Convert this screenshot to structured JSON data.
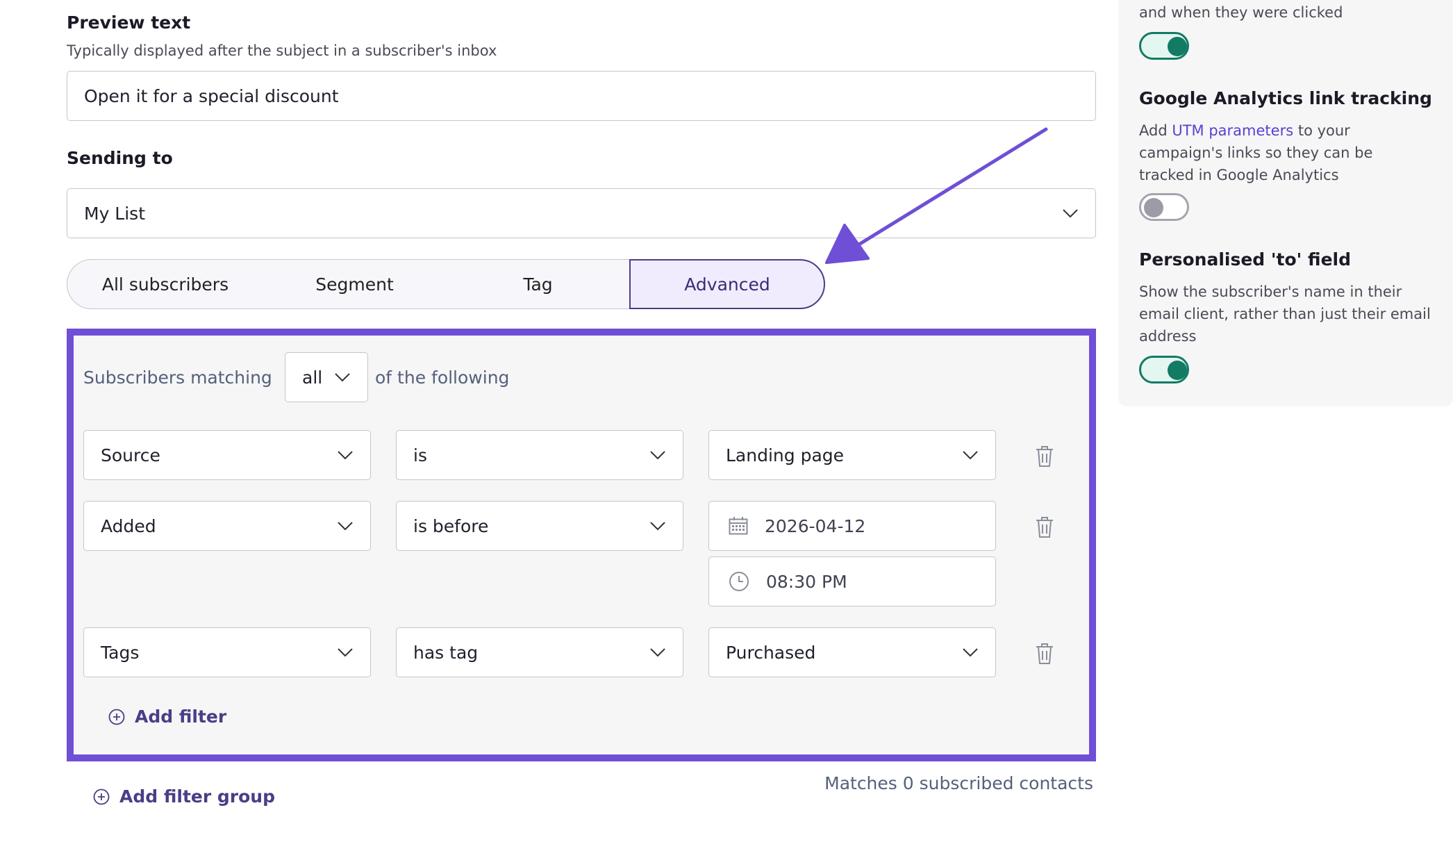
{
  "preview_text": {
    "label": "Preview text",
    "help": "Typically displayed after the subject in a subscriber's inbox",
    "value": "Open it for a special discount"
  },
  "sending_to": {
    "label": "Sending to",
    "selected": "My List"
  },
  "audience_tabs": [
    {
      "label": "All subscribers",
      "active": false
    },
    {
      "label": "Segment",
      "active": false
    },
    {
      "label": "Tag",
      "active": false
    },
    {
      "label": "Advanced",
      "active": true
    }
  ],
  "advanced": {
    "prefix": "Subscribers matching",
    "match_mode": "all",
    "suffix": "of the following",
    "filters": [
      {
        "field": "Source",
        "operator": "is",
        "value": "Landing page"
      },
      {
        "field": "Added",
        "operator": "is before",
        "date": "2026-04-12",
        "time": "08:30 PM"
      },
      {
        "field": "Tags",
        "operator": "has tag",
        "value": "Purchased"
      }
    ],
    "add_filter_label": "Add filter"
  },
  "add_filter_group_label": "Add filter group",
  "match_count_text": "Matches 0 subscribed contacts",
  "sidebar": {
    "click_tracking_tail": "and when they were clicked",
    "click_tracking_on": true,
    "ga": {
      "title": "Google Analytics link tracking",
      "text_before": "Add ",
      "link": "UTM parameters",
      "text_after": " to your campaign's links so they can be tracked in Google Analytics",
      "on": false
    },
    "personalised": {
      "title": "Personalised 'to' field",
      "text": "Show the subscriber's name in their email client, rather than just their email address",
      "on": true
    }
  },
  "colors": {
    "accent": "#6e4fd6",
    "toggle_on": "#137a63",
    "link": "#5b3fd0"
  }
}
